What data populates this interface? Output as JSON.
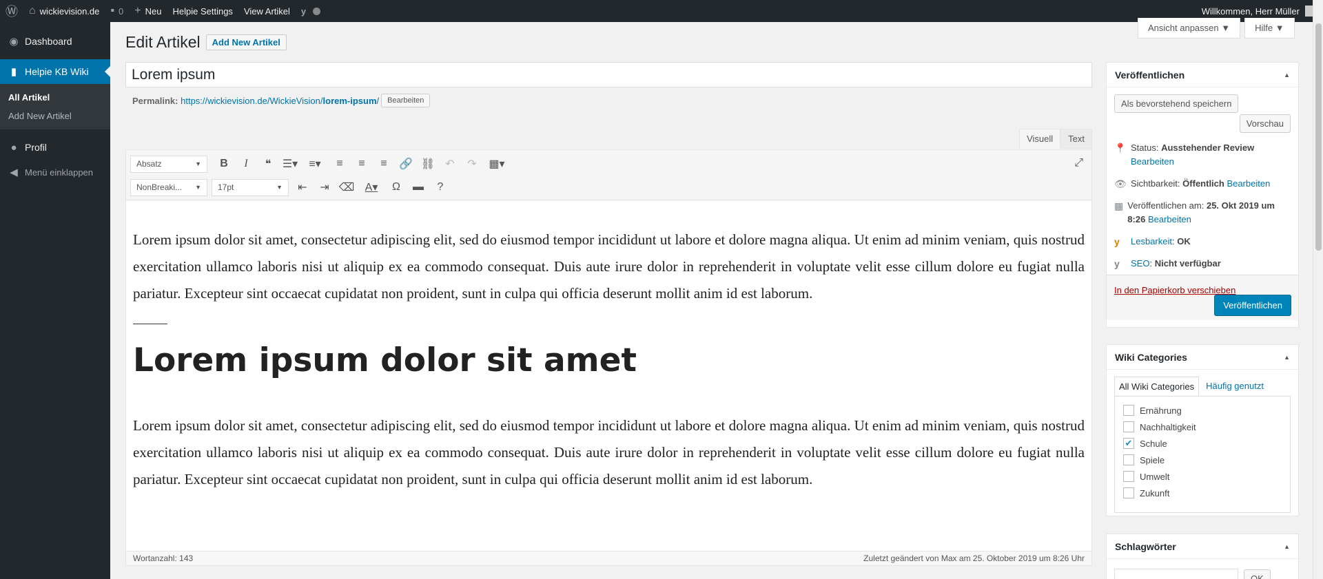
{
  "adminbar": {
    "site": "wickievision.de",
    "comments": "0",
    "new": "Neu",
    "helpie": "Helpie Settings",
    "view": "View Artikel",
    "greeting": "Willkommen, Herr Müller"
  },
  "sidebar": {
    "dashboard": "Dashboard",
    "helpie": "Helpie KB Wiki",
    "sub": [
      "All Artikel",
      "Add New Artikel"
    ],
    "profil": "Profil",
    "collapse": "Menü einklappen"
  },
  "screen": {
    "options": "Ansicht anpassen ▼",
    "help": "Hilfe ▼"
  },
  "page": {
    "title": "Edit Artikel",
    "add_new": "Add New Artikel"
  },
  "post": {
    "title": "Lorem ipsum",
    "permalink_label": "Permalink:",
    "permalink_base": "https://wickievision.de/WickieVision/",
    "permalink_slug": "lorem-ipsum",
    "permalink_end": "/",
    "edit": "Bearbeiten"
  },
  "editor": {
    "tab_visual": "Visuell",
    "tab_text": "Text",
    "format": "Absatz",
    "font": "NonBreaki...",
    "size": "17pt",
    "para1": "Lorem ipsum dolor sit amet, consectetur adipiscing elit, sed do eiusmod tempor incididunt ut labore et dolore magna aliqua. Ut enim ad minim veniam, quis nostrud exercitation ullamco laboris nisi ut aliquip ex ea commodo consequat. Duis aute irure dolor in reprehenderit in voluptate velit esse cillum dolore eu fugiat nulla pariatur. Excepteur sint occaecat cupidatat non proident, sunt in culpa qui officia deserunt mollit anim id est laborum.",
    "heading": "Lorem ipsum dolor sit amet",
    "para2": "Lorem ipsum dolor sit amet, consectetur adipiscing elit, sed do eiusmod tempor incididunt ut labore et dolore magna aliqua. Ut enim ad minim veniam, quis nostrud exercitation ullamco laboris nisi ut aliquip ex ea commodo consequat. Duis aute irure dolor in reprehenderit in voluptate velit esse cillum dolore eu fugiat nulla pariatur. Excepteur sint occaecat cupidatat non proident, sunt in culpa qui officia deserunt mollit anim id est laborum.",
    "wordcount": "Wortanzahl: 143",
    "lastedit": "Zuletzt geändert von Max am 25. Oktober 2019 um 8:26 Uhr"
  },
  "publish": {
    "heading": "Veröffentlichen",
    "save": "Als bevorstehend speichern",
    "preview": "Vorschau",
    "status_label": "Status:",
    "status_value": "Ausstehender Review",
    "visibility_label": "Sichtbarkeit:",
    "visibility_value": "Öffentlich",
    "date_label": "Veröffentlichen am:",
    "date_value": "25. Okt 2019 um 8:26",
    "edit": "Bearbeiten",
    "read_label": "Lesbarkeit",
    "read_value": "OK",
    "seo_label": "SEO",
    "seo_value": "Nicht verfügbar",
    "trash": "In den Papierkorb verschieben",
    "publish": "Veröffentlichen"
  },
  "categories": {
    "heading": "Wiki Categories",
    "tab_all": "All Wiki Categories",
    "tab_popular": "Häufig genutzt",
    "items": [
      {
        "label": "Ernährung",
        "checked": false
      },
      {
        "label": "Nachhaltigkeit",
        "checked": false
      },
      {
        "label": "Schule",
        "checked": true
      },
      {
        "label": "Spiele",
        "checked": false
      },
      {
        "label": "Umwelt",
        "checked": false
      },
      {
        "label": "Zukunft",
        "checked": false
      }
    ]
  },
  "tags": {
    "heading": "Schlagwörter",
    "ok": "OK"
  }
}
